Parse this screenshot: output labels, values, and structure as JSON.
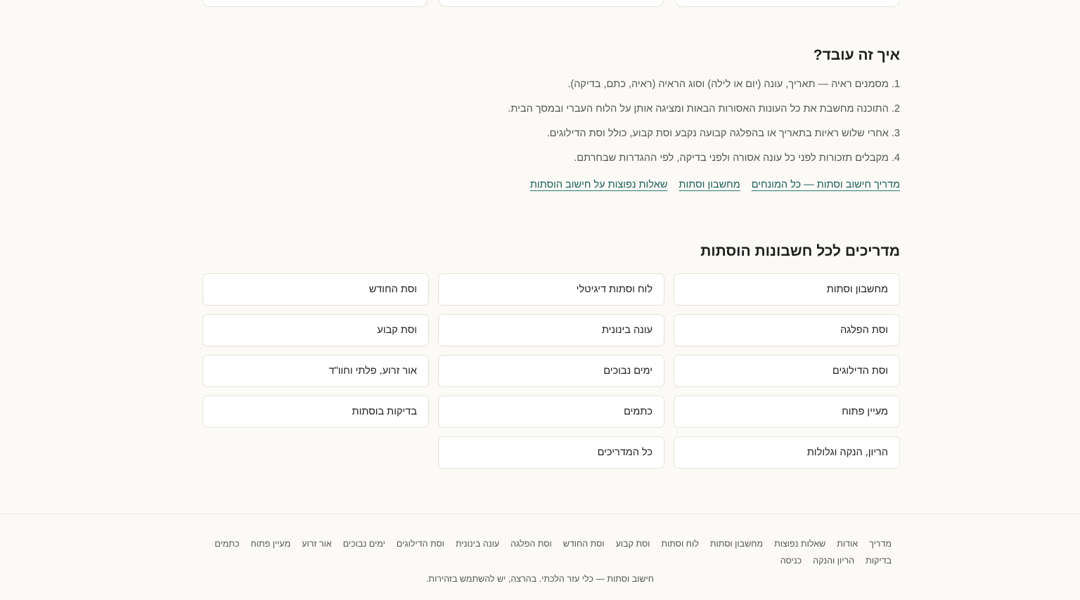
{
  "how_it_works": {
    "title": "איך זה עובד?",
    "steps": [
      "1. מסמנים ראיה — תאריך, עונה (יום או לילה) וסוג הראיה (ראיה, כתם, בדיקה).",
      "2. התוכנה מחשבת את כל העונות האסורות הבאות ומציגה אותן על הלוח העברי ובמסך הבית.",
      "3. אחרי שלוש ראיות בתאריך או בהפלגה קבועה נקבע וסת קבוע, כולל וסת הדילוגים.",
      "4. מקבלים תזכורות לפני כל עונה אסורה ולפני בדיקה, לפי ההגדרות שבחרתם."
    ],
    "links": [
      "מדריך חישוב וסתות — כל המונחים",
      "מחשבון וסתות",
      "שאלות נפוצות על חישוב הוסתות"
    ]
  },
  "guides": {
    "title": "מדריכים לכל חשבונות הוסתות",
    "cards": [
      "מחשבון וסתות",
      "לוח וסתות דיגיטלי",
      "וסת החודש",
      "וסת הפלגה",
      "עונה בינונית",
      "וסת קבוע",
      "וסת הדילוגים",
      "ימים נבוכים",
      "אור זרוע, פלתי וחוו\"ד",
      "מעיין פתוח",
      "כתמים",
      "בדיקות בוסתות",
      "הריון, הנקה וגלולות",
      "כל המדריכים"
    ]
  },
  "footer": {
    "nav": [
      "מדריך",
      "אודות",
      "שאלות נפוצות",
      "מחשבון וסתות",
      "לוח וסתות",
      "וסת קבוע",
      "וסת החודש",
      "וסת הפלגה",
      "עונה בינונית",
      "וסת הדילוגים",
      "ימים נבוכים",
      "אור זרוע",
      "מעיין פתוח",
      "כתמים",
      "בדיקות",
      "הריון והנקה",
      "כניסה"
    ],
    "disclaimer": "חישוב וסתות — כלי עזר הלכתי. בהרצה, יש להשתמש בזהירות."
  }
}
